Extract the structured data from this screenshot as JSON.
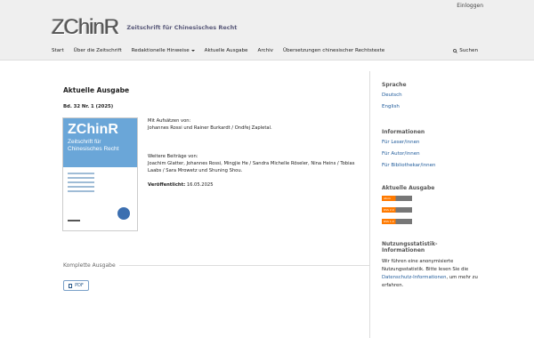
{
  "header": {
    "login": "Einloggen",
    "logo_mark": "ZChinR",
    "logo_text": "Zeitschrift für Chinesisches Recht",
    "nav": [
      "Start",
      "Über die Zeitschrift",
      "Redaktionelle Hinweise",
      "Aktuelle Ausgabe",
      "Archiv",
      "Übersetzungen chinesischer Rechtstexte"
    ],
    "search": "Suchen"
  },
  "main": {
    "title": "Aktuelle Ausgabe",
    "issue": "Bd. 32 Nr. 1 (2025)",
    "cover": {
      "logo": "ZChinR",
      "title_line1": "Zeitschrift für",
      "title_line2": "Chinesisches Recht"
    },
    "articles_label": "Mit Aufsätzen von:",
    "articles_authors": "Johannes Rossi und Rainer Burkardt / Ondřej Zapletal.",
    "other_label": "Weitere Beiträge von:",
    "other_authors": "Joachim Glatter, Johannes Rossi, Mingjie He / Sandra Michelle Röseler, Nina Heins / Tobias Laabs / Sara Mrowetz und Shuning Shou.",
    "published_label": "Veröffentlicht:",
    "published_date": "16.05.2025",
    "complete_label": "Komplette Ausgabe",
    "pdf_label": "PDF"
  },
  "sidebar": {
    "language_heading": "Sprache",
    "languages": [
      "Deutsch",
      "English"
    ],
    "info_heading": "Informationen",
    "info_links": [
      "Für Leser/innen",
      "Für Autor/innen",
      "Für Bibliothekar/innen"
    ],
    "current_heading": "Aktuelle Ausgabe",
    "feed_labels": [
      "Atom",
      "RSS 2.0",
      "RSS 1.0"
    ],
    "stats_heading_line1": "Nutzungsstatistik-",
    "stats_heading_line2": "Informationen",
    "stats_text_1": "Wir führen eine anonymisierte Nutzungsstatistik. Bitte lesen Sie die",
    "stats_link": "Datenschutz-Informationen",
    "stats_text_2": ", um mehr zu erfahren."
  },
  "colors": {
    "link": "#1e5a9a",
    "header_bg": "#efefef",
    "cover_blue": "#6aa6d8"
  }
}
